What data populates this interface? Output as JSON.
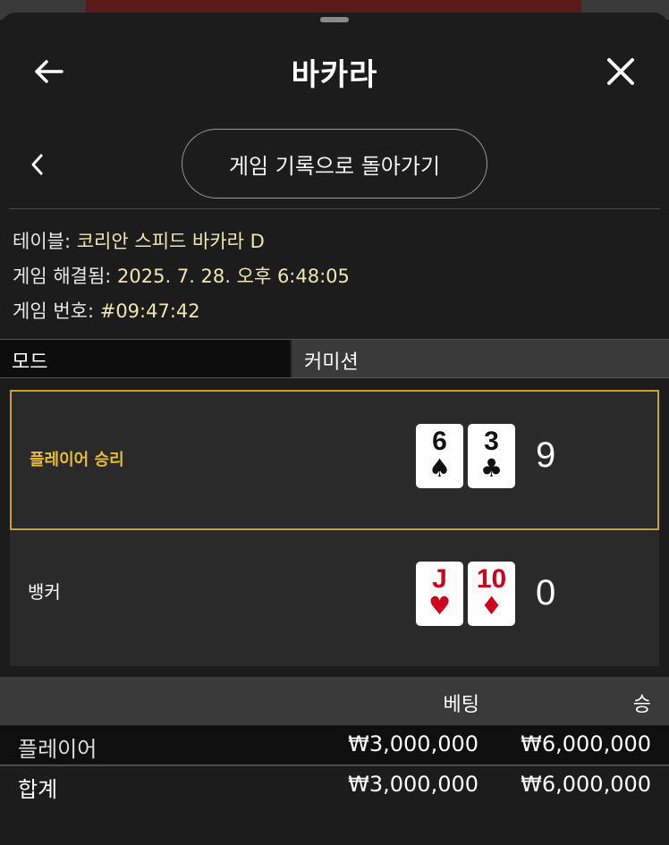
{
  "header": {
    "title": "바카라",
    "back_icon": "arrow-left-icon",
    "close_icon": "close-icon"
  },
  "nav": {
    "sub_back_icon": "chevron-left-icon",
    "history_button": "게임 기록으로 돌아가기"
  },
  "info": {
    "table_label": "테이블:",
    "table_value": "코리안 스피드 바카라 D",
    "resolved_label": "게임 해결됨:",
    "resolved_value": "2025. 7. 28. 오후 6:48:05",
    "game_no_label": "게임 번호:",
    "game_no_value": "#09:47:42"
  },
  "mode": {
    "label": "모드",
    "value": "커미션"
  },
  "hands": {
    "player": {
      "label": "플레이어 승리",
      "cards": [
        {
          "rank": "6",
          "suit": "♠",
          "color": "black"
        },
        {
          "rank": "3",
          "suit": "♣",
          "color": "black"
        }
      ],
      "score": "9"
    },
    "banker": {
      "label": "뱅커",
      "cards": [
        {
          "rank": "J",
          "suit": "♥",
          "color": "red"
        },
        {
          "rank": "10",
          "suit": "♦",
          "color": "red"
        }
      ],
      "score": "0"
    }
  },
  "bets": {
    "columns": {
      "bet": "베팅",
      "win": "승"
    },
    "rows": [
      {
        "name": "플레이어",
        "bet": "₩3,000,000",
        "win": "₩6,000,000"
      }
    ],
    "total": {
      "name": "합계",
      "bet": "₩3,000,000",
      "win": "₩6,000,000"
    }
  },
  "colors": {
    "accent": "#c9a227",
    "value_text": "#f0e6b2",
    "red_suit": "#d0021b"
  }
}
